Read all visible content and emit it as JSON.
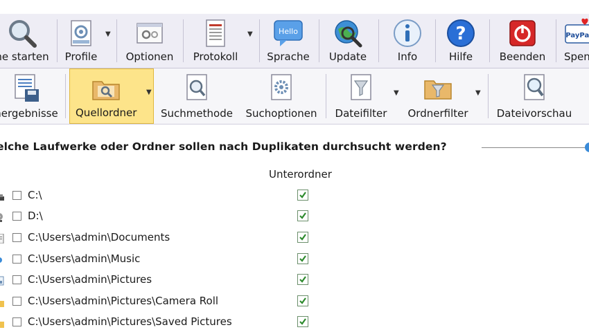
{
  "toolbar_main": {
    "items": [
      {
        "label": "ne starten",
        "icon": "magnifier-icon"
      },
      {
        "label": "Profile",
        "icon": "profile-gear-icon",
        "dropdown": true
      },
      {
        "label": "Optionen",
        "icon": "options-window-icon"
      },
      {
        "label": "Protokoll",
        "icon": "log-document-icon",
        "dropdown": true
      },
      {
        "label": "Sprache",
        "icon": "speech-bubble-icon",
        "icon_text": "Hello"
      },
      {
        "label": "Update",
        "icon": "globe-magnifier-icon"
      },
      {
        "label": "Info",
        "icon": "info-icon"
      },
      {
        "label": "Hilfe",
        "icon": "help-icon"
      },
      {
        "label": "Beenden",
        "icon": "power-icon"
      },
      {
        "label": "Spen",
        "icon": "paypal-heart-icon",
        "icon_text": "PayPal"
      }
    ]
  },
  "toolbar_sub": {
    "items": [
      {
        "label": "nergebnisse",
        "icon": "save-results-icon"
      },
      {
        "label": "Quellordner",
        "icon": "folder-search-icon",
        "active": true,
        "dropdown": true
      },
      {
        "label": "Suchmethode",
        "icon": "search-document-icon"
      },
      {
        "label": "Suchoptionen",
        "icon": "gear-document-icon"
      },
      {
        "label": "Dateifilter",
        "icon": "file-filter-icon",
        "dropdown": true
      },
      {
        "label": "Ordnerfilter",
        "icon": "folder-filter-icon",
        "dropdown": true
      },
      {
        "label": "Dateivorschau",
        "icon": "file-preview-icon"
      }
    ]
  },
  "main": {
    "question": "elche Laufwerke oder Ordner sollen nach Duplikaten durchsucht werden?",
    "column_header": "Unterordner",
    "rows": [
      {
        "path": "C:\\",
        "checked": false,
        "subfolders": true,
        "icon": "drive-icon"
      },
      {
        "path": "D:\\",
        "checked": false,
        "subfolders": true,
        "icon": "disc-drive-icon"
      },
      {
        "path": "C:\\Users\\admin\\Documents",
        "checked": false,
        "subfolders": true,
        "icon": "documents-icon"
      },
      {
        "path": "C:\\Users\\admin\\Music",
        "checked": false,
        "subfolders": true,
        "icon": "music-icon"
      },
      {
        "path": "C:\\Users\\admin\\Pictures",
        "checked": false,
        "subfolders": true,
        "icon": "pictures-icon"
      },
      {
        "path": "C:\\Users\\admin\\Pictures\\Camera Roll",
        "checked": false,
        "subfolders": true,
        "icon": "folder-icon"
      },
      {
        "path": "C:\\Users\\admin\\Pictures\\Saved Pictures",
        "checked": false,
        "subfolders": true,
        "icon": "folder-icon"
      }
    ]
  },
  "colors": {
    "accent": "#fde48a",
    "check": "#2e8b2e",
    "toolbar": "#eeedf5"
  }
}
